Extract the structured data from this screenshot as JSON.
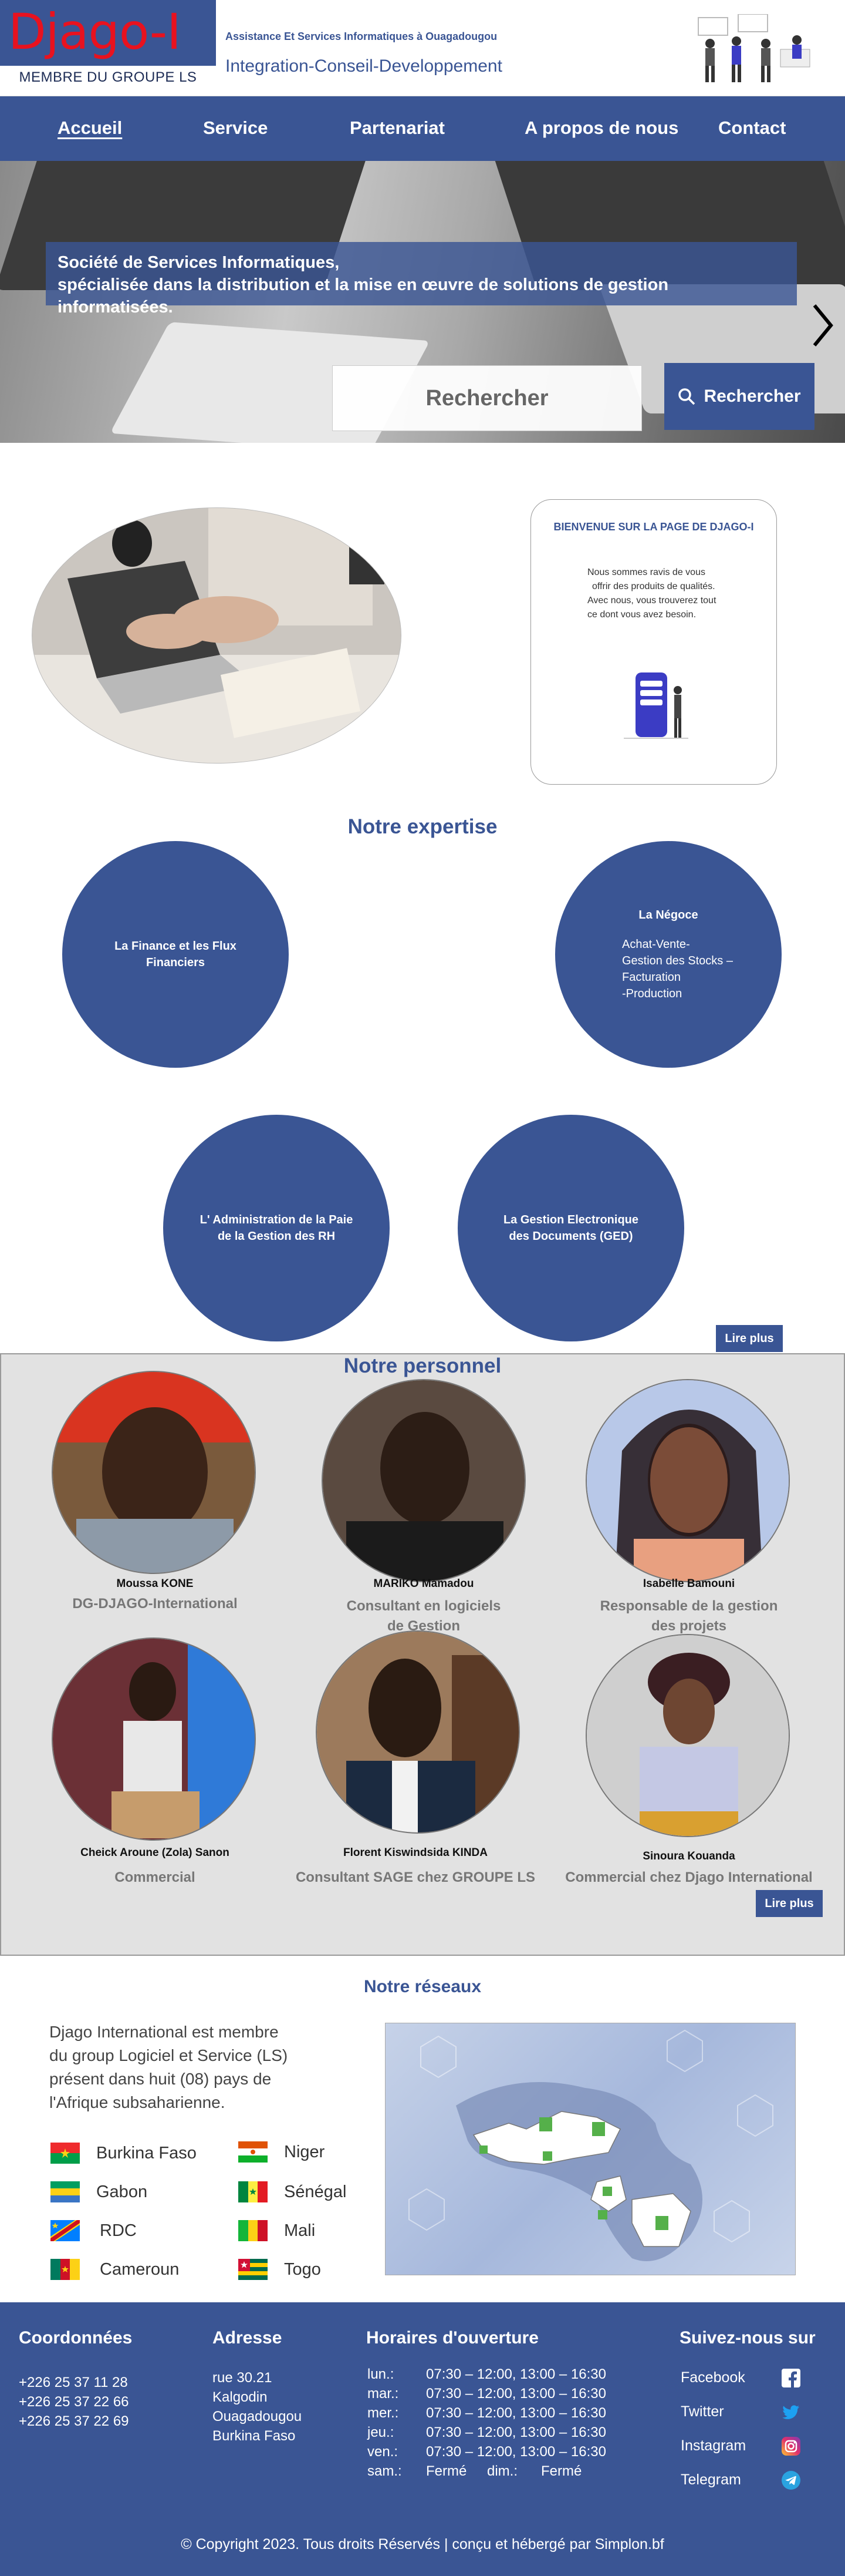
{
  "header": {
    "logo": "Djago-I",
    "member": "MEMBRE DU GROUPE LS",
    "tagline_small": "Assistance Et Services Informatiques à Ouagadougou",
    "tagline_big": "Integration-Conseil-Developpement"
  },
  "nav": [
    {
      "label": "Accueil",
      "active": true
    },
    {
      "label": "Service"
    },
    {
      "label": "Partenariat"
    },
    {
      "label": "A propos de nous"
    },
    {
      "label": "Contact"
    }
  ],
  "hero": {
    "line1": "Société de Services Informatiques,",
    "line2": "spécialisée dans la distribution et la mise en œuvre de solutions de gestion informatisées.",
    "search_placeholder": "Rechercher",
    "search_button": "Rechercher"
  },
  "welcome": {
    "title": "BIENVENUE SUR LA PAGE DE DJAGO-I",
    "line1": "Nous sommes ravis de vous",
    "line2": "offrir des produits de qualités.",
    "line3": "Avec nous, vous trouverez tout",
    "line4": "ce dont vous avez besoin."
  },
  "expertise": {
    "title": "Notre expertise",
    "finance_l1": "La Finance et les Flux Financiers",
    "negoce_title": "La Négoce",
    "negoce_l1": "Achat-Vente-",
    "negoce_l2": "Gestion des Stocks –",
    "negoce_l3": "Facturation",
    "negoce_l4": "-Production",
    "admin_l1": "L' Administration de la Paie",
    "admin_l2": "de la Gestion des RH",
    "ged_l1": "La Gestion Electronique",
    "ged_l2": "des Documents (GED)",
    "read_more": "Lire plus"
  },
  "staff": {
    "title": "Notre personnel",
    "read_more": "Lire plus",
    "people": [
      {
        "name": "Moussa KONE",
        "role_l1": "DG-DJAGO-International",
        "role_l2": ""
      },
      {
        "name": "MARIKO Mamadou",
        "role_l1": "Consultant en logiciels",
        "role_l2": "de Gestion"
      },
      {
        "name": "Isabelle Bamouni",
        "role_l1": "Responsable de la gestion",
        "role_l2": "des projets"
      },
      {
        "name": "Cheick Aroune (Zola) Sanon",
        "role_l1": "Commercial",
        "role_l2": ""
      },
      {
        "name": "Florent Kiswindsida KINDA",
        "role_l1": "Consultant SAGE chez GROUPE LS",
        "role_l2": ""
      },
      {
        "name": "Sinoura Kouanda",
        "role_l1": "Commercial chez Djago International",
        "role_l2": ""
      }
    ]
  },
  "network": {
    "title": "Notre réseaux",
    "text_l1": "Djago International est membre",
    "text_l2": "du group Logiciel et Service (LS)",
    "text_l3": "présent dans huit (08) pays de",
    "text_l4": "l'Afrique subsaharienne.",
    "countries": [
      "Burkina Faso",
      "Niger",
      "Gabon",
      "Sénégal",
      "RDC",
      "Mali",
      "Cameroun",
      "Togo"
    ]
  },
  "footer": {
    "coord_title": "Coordonnées",
    "phones": [
      "+226 25 37 11 28",
      "+226 25 37 22 66",
      "+226 25 37 22 69"
    ],
    "address_title": "Adresse",
    "address": [
      "rue 30.21",
      "Kalgodin",
      "Ouagadougou",
      "Burkina Faso"
    ],
    "hours_title": "Horaires d'ouverture",
    "hours": [
      {
        "day": "lun.:",
        "time": "07:30 – 12:00, 13:00 – 16:30"
      },
      {
        "day": "mar.:",
        "time": "07:30 – 12:00, 13:00 – 16:30"
      },
      {
        "day": "mer.:",
        "time": "07:30 – 12:00, 13:00 – 16:30"
      },
      {
        "day": "jeu.:",
        "time": "07:30 – 12:00, 13:00 – 16:30"
      },
      {
        "day": "ven.:",
        "time": "07:30 – 12:00, 13:00 – 16:30"
      }
    ],
    "sat_day": "sam.:",
    "sat_time": "Fermé",
    "sun_day": "dim.:",
    "sun_time": "Fermé",
    "follow_title": "Suivez-nous sur",
    "social": [
      "Facebook",
      "Twitter",
      "Instagram",
      "Telegram"
    ],
    "copyright": "© Copyright 2023. Tous droits Réservés | conçu et hébergé par Simplon.bf"
  },
  "colors": {
    "brand": "#3a5594",
    "logo": "#e8121f",
    "staff_bg": "#e2e2e2"
  }
}
